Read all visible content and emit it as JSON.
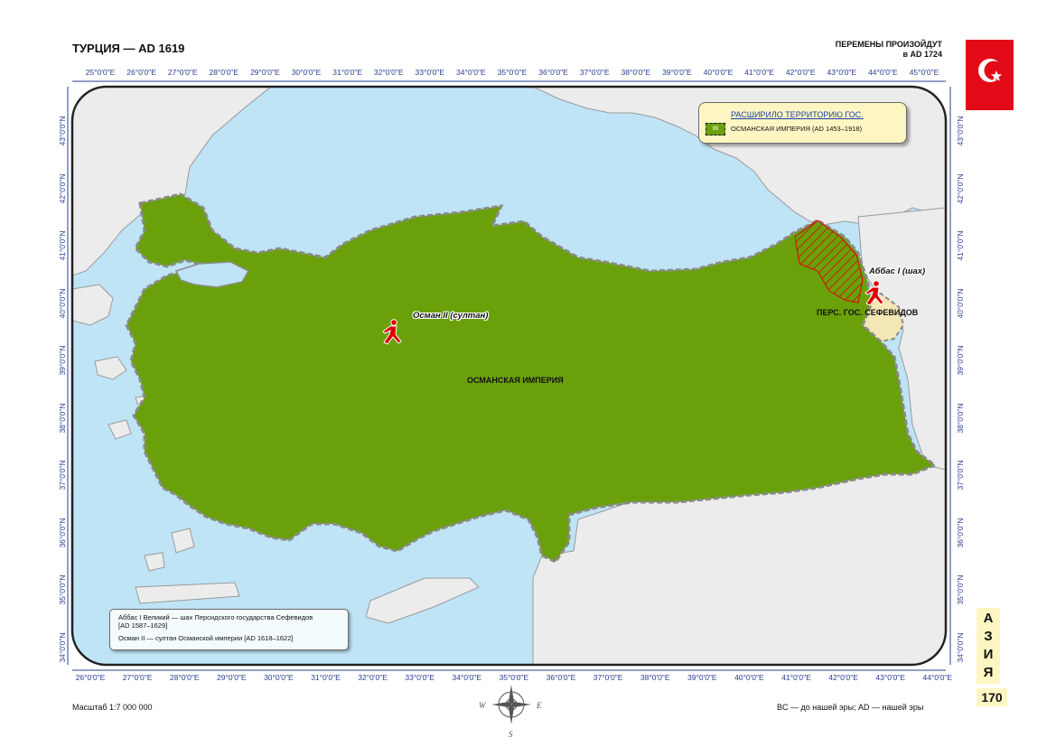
{
  "header": {
    "title": "ТУРЦИЯ — AD 1619",
    "changes_line1": "ПЕРЕМЕНЫ ПРОИЗОЙДУТ",
    "changes_line2": "в AD 1724"
  },
  "top_ticks": [
    "25°0'0\"E",
    "26°0'0\"E",
    "27°0'0\"E",
    "28°0'0\"E",
    "29°0'0\"E",
    "30°0'0\"E",
    "31°0'0\"E",
    "32°0'0\"E",
    "33°0'0\"E",
    "34°0'0\"E",
    "35°0'0\"E",
    "36°0'0\"E",
    "37°0'0\"E",
    "38°0'0\"E",
    "39°0'0\"E",
    "40°0'0\"E",
    "41°0'0\"E",
    "42°0'0\"E",
    "43°0'0\"E",
    "44°0'0\"E",
    "45°0'0\"E"
  ],
  "bottom_ticks": [
    "26°0'0\"E",
    "27°0'0\"E",
    "28°0'0\"E",
    "29°0'0\"E",
    "30°0'0\"E",
    "31°0'0\"E",
    "32°0'0\"E",
    "33°0'0\"E",
    "34°0'0\"E",
    "35°0'0\"E",
    "36°0'0\"E",
    "37°0'0\"E",
    "38°0'0\"E",
    "39°0'0\"E",
    "40°0'0\"E",
    "41°0'0\"E",
    "42°0'0\"E",
    "43°0'0\"E",
    "44°0'0\"E"
  ],
  "lat_ticks": [
    "43°0'0\"N",
    "42°0'0\"N",
    "41°0'0\"N",
    "40°0'0\"N",
    "39°0'0\"N",
    "38°0'0\"N",
    "37°0'0\"N",
    "36°0'0\"N",
    "35°0'0\"N",
    "34°0'0\"N"
  ],
  "legend": {
    "heading": "РАСШИРИЛО ТЕРРИТОРИЮ ГОС.",
    "swatch_code": "99",
    "item": "ОСМАНСКАЯ ИМПЕРИЯ (AD 1453–1918)"
  },
  "notes": {
    "line1a": "Аббас I Великий — шах Персидского государства Сефевидов",
    "line1b": "[AD 1587–1629]",
    "line2": "Осман II — султан Османской империи [AD 1618–1622]"
  },
  "map_labels": {
    "empire": "ОСМАНСКАЯ ИМПЕРИЯ",
    "persia": "ПЕРС. ГОС. СЕФЕВИДОВ",
    "osman": "Осман II (султан)",
    "abbas": "Аббас I (шах)"
  },
  "footer": {
    "scale": "Масштаб 1:7 000 000",
    "era": "BC — до нашей эры; AD — нашей эры",
    "asia_letters": [
      "А",
      "З",
      "И",
      "Я"
    ],
    "page_number": "170"
  },
  "colors": {
    "sea": "#bfe4f6",
    "land_other": "#ececec",
    "empire": "#6aa10b",
    "persia": "#f4e7b6",
    "ruler_icon": "#e00000",
    "flag": "#e30a17"
  },
  "icons": [
    "flag-turkey-icon",
    "running-ruler-icon",
    "compass-rose-icon"
  ]
}
